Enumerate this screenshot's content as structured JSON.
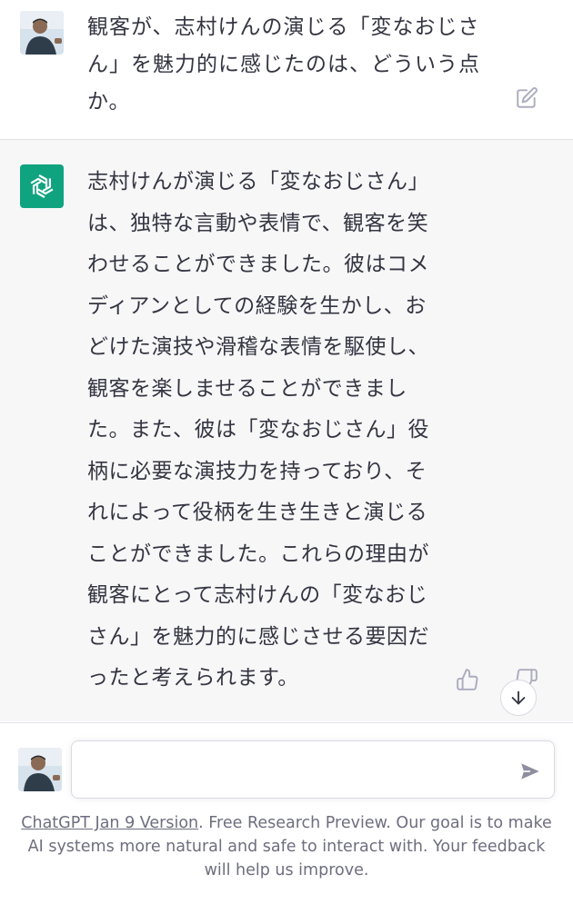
{
  "conversation": {
    "user_message": "観客が、志村けんの演じる「変なおじさん」を魅力的に感じたのは、どういう点か。",
    "assistant_message": "志村けんが演じる「変なおじさん」\nは、独特な言動や表情で、観客を笑\nわせることができました。彼はコメ\nディアンとしての経験を生かし、お\nどけた演技や滑稽な表情を駆使し、\n観客を楽しませることができまし\nた。また、彼は「変なおじさん」役\n柄に必要な演技力を持っており、そ\nれによって役柄を生き生きと演じる\nことができました。これらの理由が\n観客にとって志村けんの「変なおじ\nさん」を魅力的に感じさせる要因だ\nったと考えられます。"
  },
  "icons": {
    "edit": "edit-icon",
    "openai_logo": "openai-logo-icon",
    "thumbs_up": "thumbs-up-icon",
    "thumbs_down": "thumbs-down-icon",
    "scroll_down": "arrow-down-icon",
    "send": "send-icon"
  },
  "input": {
    "value": "",
    "placeholder": ""
  },
  "footer": {
    "version_link": "ChatGPT Jan 9 Version",
    "text": ". Free Research Preview. Our goal is to make AI systems more natural and safe to interact with. Your feedback will help us improve."
  },
  "colors": {
    "brand": "#10a37f",
    "assistant_bg": "#f7f7f8",
    "text": "#343541",
    "muted": "#6e6e80"
  }
}
